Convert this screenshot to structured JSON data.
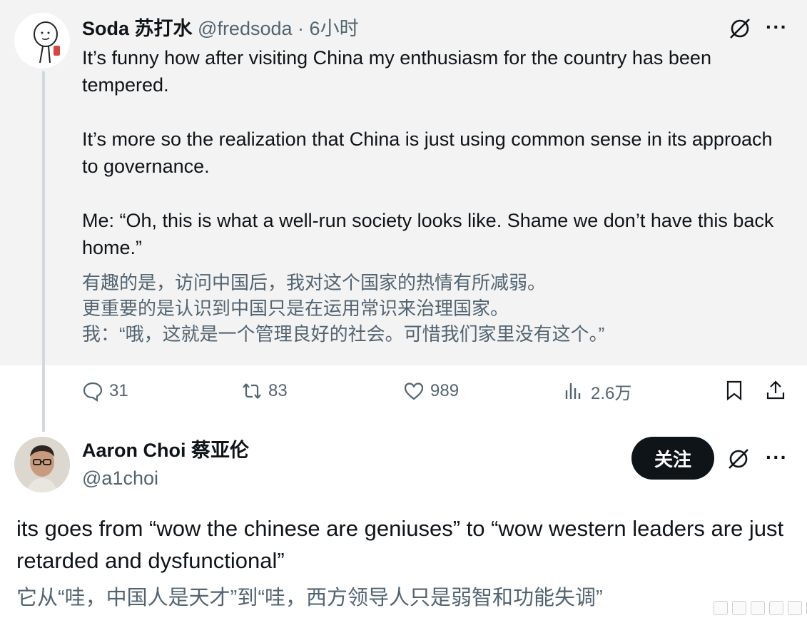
{
  "tweet": {
    "author_name": "Soda 苏打水",
    "handle": "@fredsoda",
    "separator": "·",
    "time": "6小时",
    "paragraphs": [
      "It’s funny how after visiting China my enthusiasm for the country has been tempered.",
      "It’s more so the realization that China is just using common sense in its approach to governance.",
      "Me: “Oh, this is what a well-run society looks like. Shame we don’t have this back home.”"
    ],
    "translation": [
      "有趣的是，访问中国后，我对这个国家的热情有所减弱。",
      "更重要的是认识到中国只是在运用常识来治理国家。",
      "我：“哦，这就是一个管理良好的社会。可惜我们家里没有这个。”"
    ],
    "stats": {
      "replies": "31",
      "retweets": "83",
      "likes": "989",
      "views": "2.6万"
    },
    "avatar_icon": "cartoon-avatar",
    "more_icon": "more-dots-icon",
    "grok_icon": "grok-icon"
  },
  "reply": {
    "author_name": "Aaron Choi 蔡亚伦",
    "handle": "@a1choi",
    "follow_label": "关注",
    "text": [
      "its goes from “wow the chinese are geniuses” to “wow western leaders are just retarded and dysfunctional”"
    ],
    "translation": "它从“哇，中国人是天才”到“哇，西方领导人只是弱智和功能失调”",
    "avatar_icon": "photo-avatar"
  },
  "colors": {
    "text": "#0f1419",
    "muted": "#536471",
    "tweet_bg": "#f3f3f3",
    "thread_line": "#cfd9de",
    "follow_bg": "#0f1419"
  }
}
